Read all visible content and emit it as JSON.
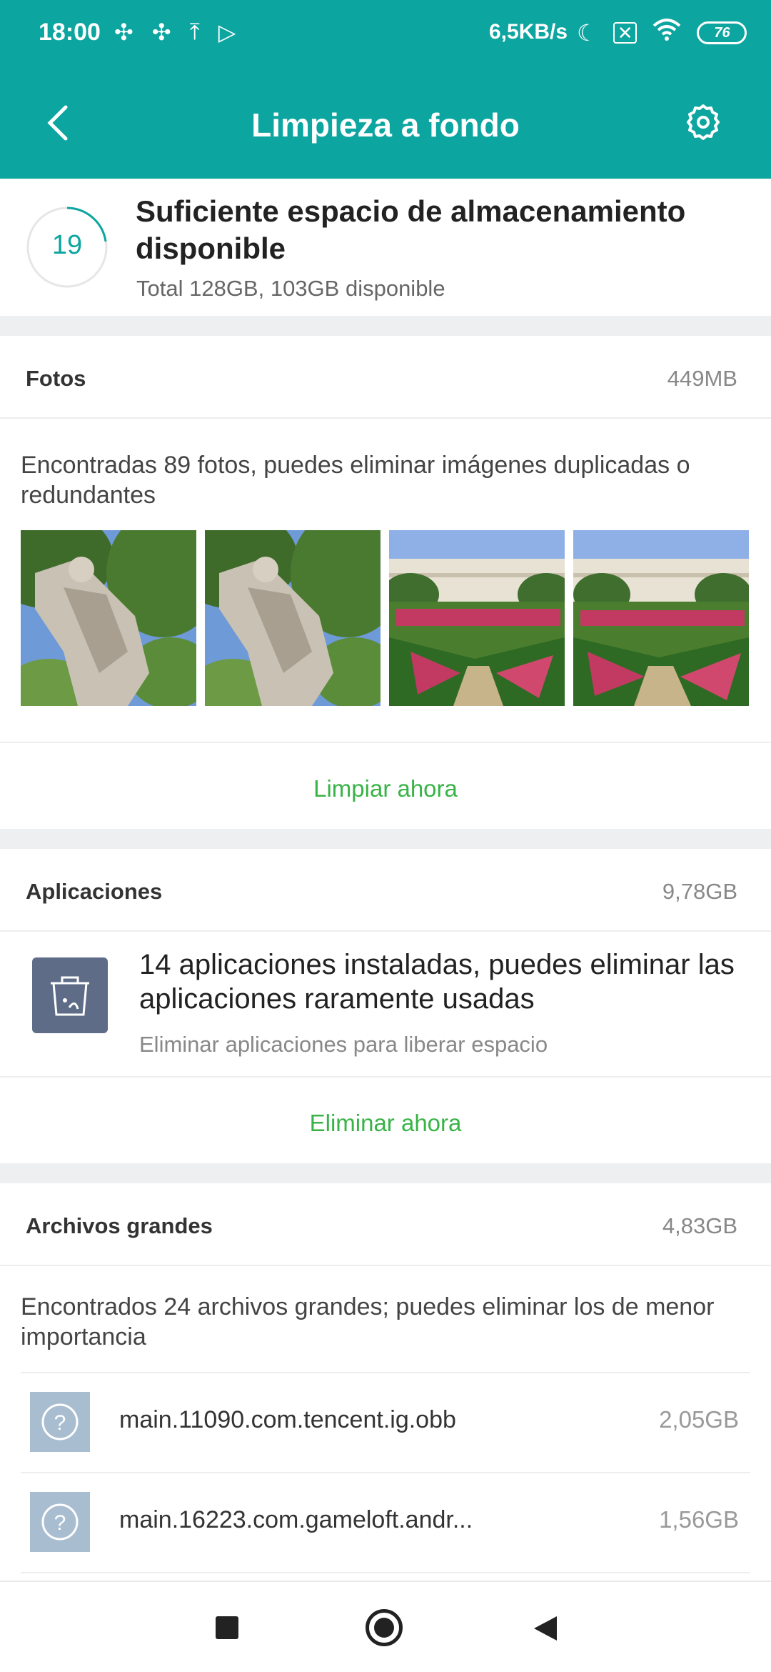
{
  "status_bar": {
    "time": "18:00",
    "net_speed": "6,5KB/s",
    "battery": "76",
    "icons": [
      "pinwheel-icon",
      "pinwheel-icon",
      "upload-icon",
      "play-store-icon",
      "moon-icon",
      "sim-x-icon",
      "wifi-icon",
      "battery-icon"
    ]
  },
  "header": {
    "title": "Limpieza a fondo"
  },
  "summary": {
    "score": "19",
    "title": "Suficiente espacio de almacenamiento disponible",
    "subtitle": "Total 128GB, 103GB disponible"
  },
  "photos": {
    "label": "Fotos",
    "size": "449MB",
    "description": "Encontradas 89 fotos, puedes eliminar imágenes duplicadas o redundantes",
    "action": "Limpiar ahora",
    "thumbnails": [
      "statue-photo",
      "statue-photo",
      "palace-garden-photo",
      "palace-garden-photo"
    ]
  },
  "apps": {
    "label": "Aplicaciones",
    "size": "9,78GB",
    "title": "14 aplicaciones instaladas, puedes eliminar las aplicaciones raramente usadas",
    "subtitle": "Eliminar aplicaciones para liberar espacio",
    "action": "Eliminar ahora"
  },
  "large_files": {
    "label": "Archivos grandes",
    "size": "4,83GB",
    "description": "Encontrados 24 archivos grandes; puedes eliminar los de menor importancia",
    "files": [
      {
        "name": "main.11090.com.tencent.ig.obb",
        "size": "2,05GB"
      },
      {
        "name": "main.16223.com.gameloft.andr...",
        "size": "1,56GB"
      }
    ]
  },
  "colors": {
    "header": "#0ca5a0",
    "action": "#38b346",
    "app_icon": "#5e6c87",
    "file_icon": "#a9bdd1"
  }
}
